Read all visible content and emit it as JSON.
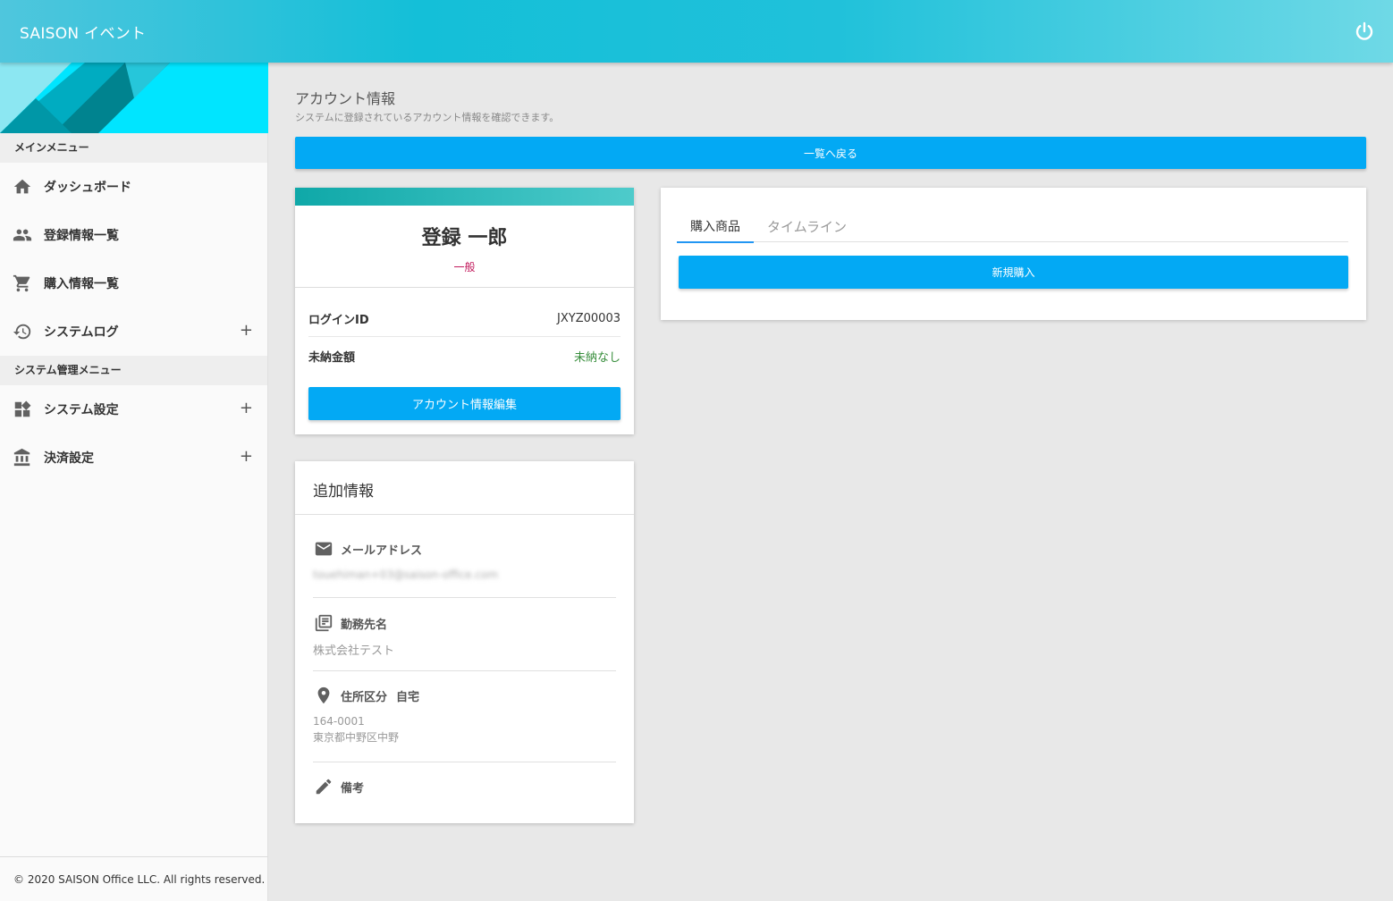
{
  "app": {
    "title": "SAISON イベント",
    "power_icon": "power-icon"
  },
  "sidebar": {
    "main_menu_header": "メインメニュー",
    "main_items": [
      {
        "label": "ダッシュボード",
        "icon": "home-icon"
      },
      {
        "label": "登録情報一覧",
        "icon": "people-icon"
      },
      {
        "label": "購入情報一覧",
        "icon": "cart-icon"
      },
      {
        "label": "システムログ",
        "icon": "history-icon",
        "expand": "+"
      }
    ],
    "admin_menu_header": "システム管理メニュー",
    "admin_items": [
      {
        "label": "システム設定",
        "icon": "dashboard-icon",
        "expand": "+"
      },
      {
        "label": "決済設定",
        "icon": "bank-icon",
        "expand": "+"
      }
    ],
    "footer": "© 2020 SAISON Office LLC. All rights reserved."
  },
  "page": {
    "title": "アカウント情報",
    "subtitle": "システムに登録されているアカウント情報を確認できます。",
    "back_button": "一覧へ戻る"
  },
  "profile": {
    "name": "登録 一郎",
    "role": "一般",
    "login_id_label": "ログインID",
    "login_id": "JXYZ00003",
    "unpaid_label": "未納金額",
    "unpaid_value": "未納なし",
    "edit_button": "アカウント情報編集"
  },
  "extra": {
    "title": "追加情報",
    "email_label": "メールアドレス",
    "email_value": "touehiman+03@saison-office.com",
    "company_label": "勤務先名",
    "company_value": "株式会社テスト",
    "address_label": "住所区分",
    "address_type": "自宅",
    "postal_code": "164-0001",
    "address": "東京都中野区中野",
    "notes_label": "備考"
  },
  "purchase": {
    "tabs": [
      "購入商品",
      "タイムライン"
    ],
    "new_button": "新規購入"
  },
  "colors": {
    "primary": "#03a9f4",
    "role": "#c2185b",
    "success": "#388e3c",
    "tab_indicator": "#2196f3"
  }
}
